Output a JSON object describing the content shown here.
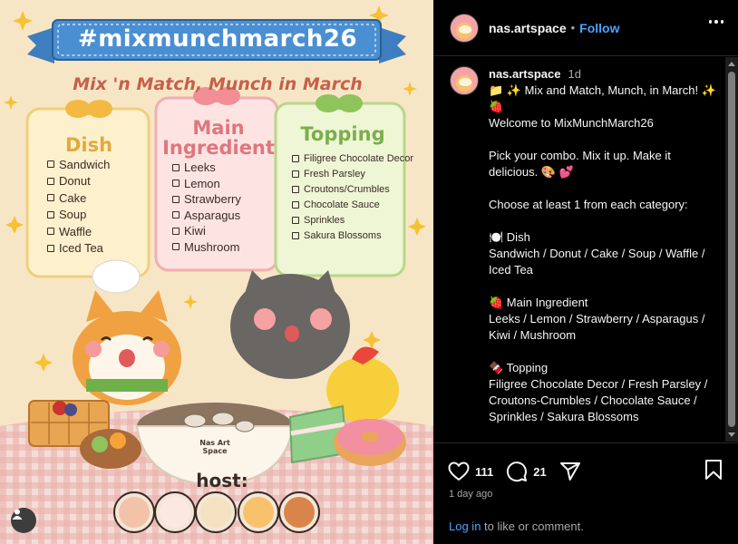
{
  "art": {
    "banner": "#mixmunchmarch26",
    "subtitle": "Mix 'n Match, Munch in March",
    "categories": [
      {
        "title": "Dish",
        "items": [
          "Sandwich",
          "Donut",
          "Cake",
          "Soup",
          "Waffle",
          "Iced Tea"
        ]
      },
      {
        "title": "Main\nIngredient",
        "items": [
          "Leeks",
          "Lemon",
          "Strawberry",
          "Asparagus",
          "Kiwi",
          "Mushroom"
        ]
      },
      {
        "title": "Topping",
        "items": [
          "Filigree Chocolate Decor",
          "Fresh Parsley",
          "Croutons/Crumbles",
          "Chocolate Sauce",
          "Sprinkles",
          "Sakura Blossoms"
        ]
      }
    ],
    "bowl_label": "Nas Art Space",
    "host_label": "host:"
  },
  "header": {
    "username": "nas.artspace",
    "separator": "•",
    "follow_label": "Follow",
    "more_icon": "more-horizontal-icon"
  },
  "caption": {
    "username": "nas.artspace",
    "time": "1d",
    "lines": [
      "📁 ✨ Mix and Match, Munch, in March! ✨ 🍓",
      "Welcome to MixMunchMarch26",
      "",
      "Pick your combo. Mix it up. Make it delicious. 🎨 💕",
      "",
      "Choose at least 1 from each category:",
      "",
      "🍽️ Dish",
      "Sandwich / Donut / Cake / Soup / Waffle / Iced Tea",
      "",
      "🍓 Main Ingredient",
      "Leeks / Lemon / Strawberry / Asparagus / Kiwi / Mushroom",
      "",
      "🍫 Topping",
      "Filigree Chocolate Decor / Fresh Parsley / Croutons-Crumbles / Chocolate Sauce / Sprinkles / Sakura Blossoms"
    ]
  },
  "actions": {
    "likes": "111",
    "comments": "21",
    "posted": "1 day ago",
    "login_link": "Log in",
    "login_rest": " to like or comment."
  },
  "colors": {
    "accent_blue": "#4aa3ff",
    "panel_bg": "#000000",
    "muted": "#a8a8a8"
  }
}
